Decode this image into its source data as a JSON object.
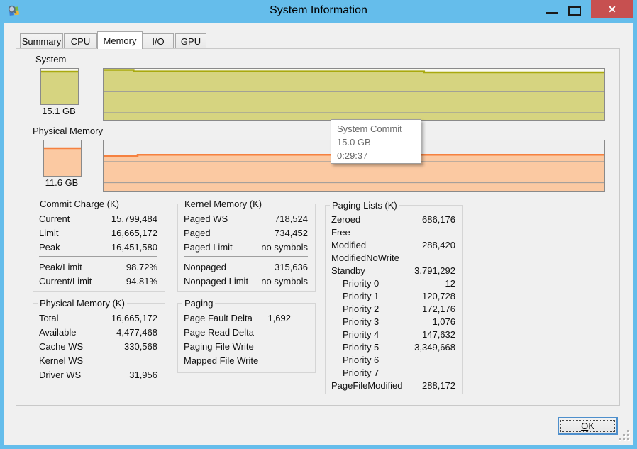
{
  "window": {
    "title": "System Information"
  },
  "tabs": {
    "active": "Memory",
    "items": [
      {
        "label": "Summary"
      },
      {
        "label": "CPU"
      },
      {
        "label": "Memory"
      },
      {
        "label": "I/O"
      },
      {
        "label": "GPU"
      }
    ]
  },
  "graphs": {
    "system": {
      "label": "System",
      "gauge_value": "15.1 GB",
      "colors": {
        "line": "#A9A90F",
        "fill": "#D6D480",
        "bg": "#FAFAF2"
      },
      "gauge": {
        "points": [
          [
            0,
            8
          ],
          [
            100,
            8
          ]
        ]
      },
      "history": {
        "points": [
          [
            0,
            2
          ],
          [
            6,
            2
          ],
          [
            6,
            5
          ],
          [
            64,
            5
          ],
          [
            64,
            7
          ],
          [
            100,
            7
          ]
        ],
        "gridlines": [
          44,
          86
        ]
      }
    },
    "physical": {
      "label": "Physical Memory",
      "gauge_value": "11.6 GB",
      "colors": {
        "line": "#F58140",
        "fill": "#FBC9A2",
        "bg": "#EFEFEF"
      },
      "gauge": {
        "points": [
          [
            0,
            22
          ],
          [
            100,
            22
          ]
        ]
      },
      "history": {
        "points": [
          [
            0,
            31
          ],
          [
            6.8,
            31
          ],
          [
            6.8,
            28.5
          ],
          [
            100,
            28.5
          ]
        ],
        "gridlines": [
          42,
          84
        ]
      }
    }
  },
  "tooltip": {
    "title": "System Commit",
    "value": "15.0 GB",
    "time": "0:29:37"
  },
  "groups": {
    "commit_charge": {
      "title": "Commit Charge (K)",
      "rows": [
        {
          "label": "Current",
          "value": "15,799,484"
        },
        {
          "label": "Limit",
          "value": "16,665,172"
        },
        {
          "label": "Peak",
          "value": "16,451,580"
        },
        {
          "sep": true
        },
        {
          "label": "Peak/Limit",
          "value": "98.72%"
        },
        {
          "label": "Current/Limit",
          "value": "94.81%"
        }
      ]
    },
    "kernel_memory": {
      "title": "Kernel Memory (K)",
      "rows": [
        {
          "label": "Paged WS",
          "value": "718,524"
        },
        {
          "label": "Paged",
          "value": "734,452"
        },
        {
          "label": "Paged Limit",
          "value": "no symbols"
        },
        {
          "sep": true
        },
        {
          "label": "Nonpaged",
          "value": "315,636"
        },
        {
          "label": "Nonpaged Limit",
          "value": "no symbols"
        }
      ]
    },
    "paging_lists": {
      "title": "Paging Lists (K)",
      "rows": [
        {
          "label": "Zeroed",
          "value": "686,176"
        },
        {
          "label": "Free",
          "value": ""
        },
        {
          "label": "Modified",
          "value": "288,420"
        },
        {
          "label": "ModifiedNoWrite",
          "value": ""
        },
        {
          "label": "Standby",
          "value": "3,791,292"
        },
        {
          "label": "Priority 0",
          "value": "12",
          "indent": true
        },
        {
          "label": "Priority 1",
          "value": "120,728",
          "indent": true
        },
        {
          "label": "Priority 2",
          "value": "172,176",
          "indent": true
        },
        {
          "label": "Priority 3",
          "value": "1,076",
          "indent": true
        },
        {
          "label": "Priority 4",
          "value": "147,632",
          "indent": true
        },
        {
          "label": "Priority 5",
          "value": "3,349,668",
          "indent": true
        },
        {
          "label": "Priority 6",
          "value": "",
          "indent": true
        },
        {
          "label": "Priority 7",
          "value": "",
          "indent": true
        },
        {
          "label": "PageFileModified",
          "value": "288,172"
        }
      ]
    },
    "physical_memory": {
      "title": "Physical Memory (K)",
      "rows": [
        {
          "label": "Total",
          "value": "16,665,172"
        },
        {
          "label": "Available",
          "value": "4,477,468"
        },
        {
          "label": "Cache WS",
          "value": "330,568"
        },
        {
          "label": "Kernel WS",
          "value": ""
        },
        {
          "label": "Driver WS",
          "value": "31,956"
        }
      ]
    },
    "paging": {
      "title": "Paging",
      "rows": [
        {
          "label": "Page Fault Delta",
          "value": "1,692"
        },
        {
          "label": "Page Read Delta",
          "value": ""
        },
        {
          "label": "Paging File Write",
          "value": ""
        },
        {
          "label": "Mapped File Write",
          "value": ""
        }
      ]
    }
  },
  "footer": {
    "ok_label": "OK",
    "ok_label_accel": "O",
    "ok_label_rest": "K"
  }
}
